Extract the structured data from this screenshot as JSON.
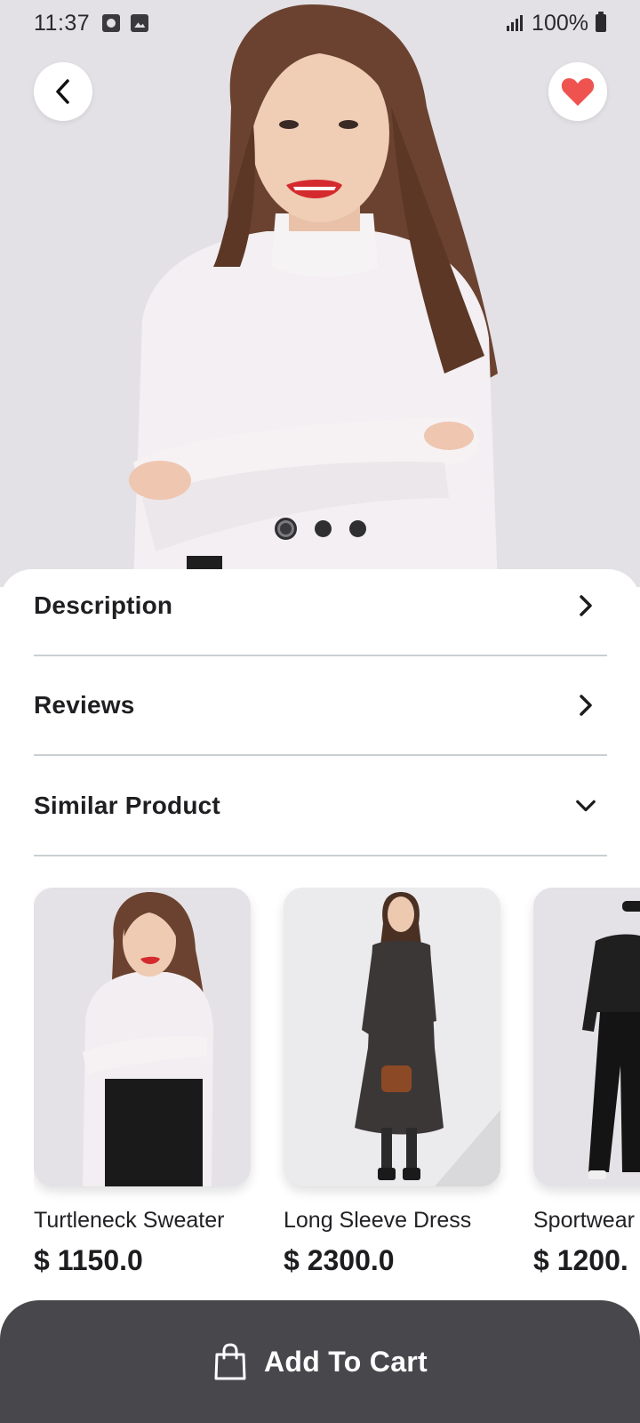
{
  "status_bar": {
    "time": "11:37",
    "battery": "100%"
  },
  "hero": {
    "image_alt": "Woman in white turtleneck sweater",
    "slide_count": 3,
    "active_slide": 1
  },
  "sections": [
    {
      "label": "Description",
      "icon": "chevron-right-icon"
    },
    {
      "label": "Reviews",
      "icon": "chevron-right-icon"
    },
    {
      "label": "Similar Product",
      "icon": "chevron-down-icon"
    }
  ],
  "products": [
    {
      "name": "Turtleneck Sweater",
      "price": "$ 1150.0"
    },
    {
      "name": "Long Sleeve Dress",
      "price": "$ 2300.0"
    },
    {
      "name": "Sportwear",
      "price": "$ 1200."
    }
  ],
  "cart": {
    "label": "Add To Cart",
    "icon": "shopping-bag-icon"
  },
  "colors": {
    "favorite": "#ef5350",
    "cart_bar": "#48474c",
    "divider": "#c9d0d3"
  }
}
